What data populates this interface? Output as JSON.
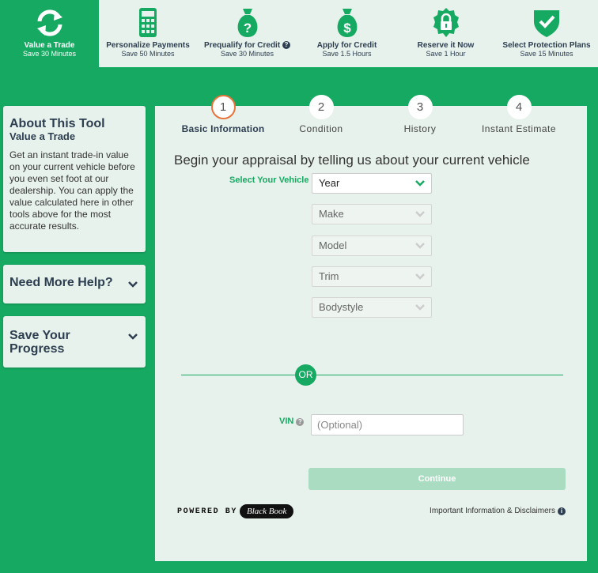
{
  "nav": [
    {
      "title": "Value a Trade",
      "sub": "Save 30 Minutes",
      "icon": "refresh-icon"
    },
    {
      "title": "Personalize Payments",
      "sub": "Save 50 Minutes",
      "icon": "calculator-icon"
    },
    {
      "title": "Prequalify for Credit",
      "sub": "Save 30 Minutes",
      "icon": "money-bag-question-icon"
    },
    {
      "title": "Apply for Credit",
      "sub": "Save 1.5 Hours",
      "icon": "money-bag-dollar-icon"
    },
    {
      "title": "Reserve it Now",
      "sub": "Save 1 Hour",
      "icon": "lock-badge-icon"
    },
    {
      "title": "Select Protection Plans",
      "sub": "Save 15 Minutes",
      "icon": "shield-check-icon"
    }
  ],
  "sidebar": {
    "about_title": "About This Tool",
    "about_subtitle": "Value a Trade",
    "about_text": "Get an instant trade-in value on your current vehicle before you even set foot at our dealership. You can apply the value calculated here in other tools above for the most accurate results.",
    "help_title": "Need More Help?",
    "save_title": "Save Your Progress"
  },
  "steps": [
    {
      "number": "1",
      "label": "Basic Information"
    },
    {
      "number": "2",
      "label": "Condition"
    },
    {
      "number": "3",
      "label": "History"
    },
    {
      "number": "4",
      "label": "Instant Estimate"
    }
  ],
  "form": {
    "heading": "Begin your appraisal by telling us about your current vehicle",
    "select_label": "Select Your Vehicle",
    "selects": [
      "Year",
      "Make",
      "Model",
      "Trim",
      "Bodystyle"
    ],
    "or_label": "OR",
    "vin_label": "VIN",
    "vin_placeholder": "(Optional)",
    "continue_label": "Continue"
  },
  "footer": {
    "powered_by": "POWERED BY",
    "logo_text": "Black Book",
    "disclaimer": "Important Information & Disclaimers"
  },
  "colors": {
    "brand_green": "#15a961",
    "panel_bg": "#e8f2ec",
    "active_step": "#e8743b"
  }
}
